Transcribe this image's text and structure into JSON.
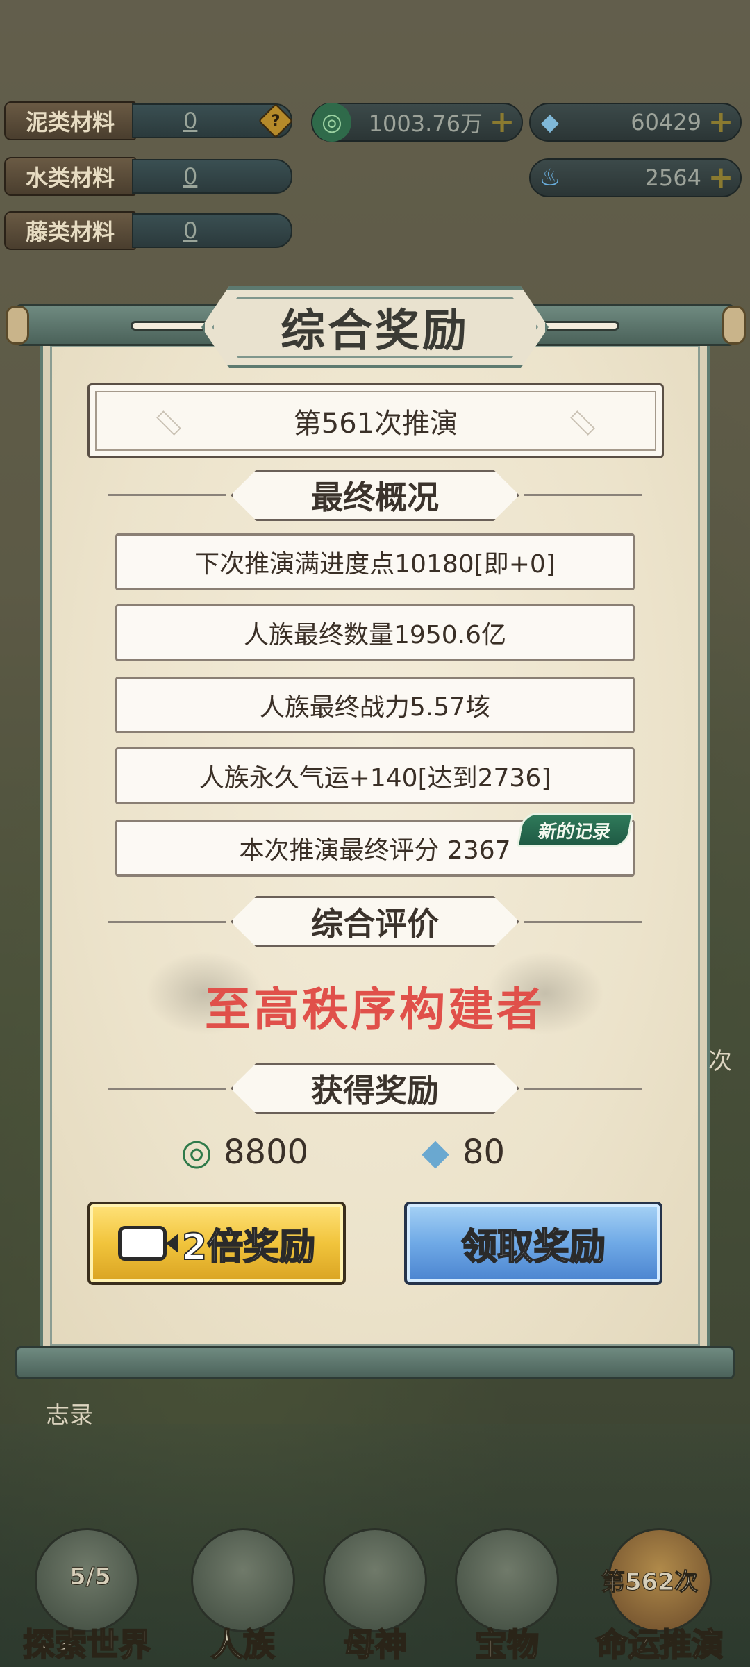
{
  "materials": [
    {
      "label": "泥类材料",
      "value": "0"
    },
    {
      "label": "水类材料",
      "value": "0"
    },
    {
      "label": "藤类材料",
      "value": "0"
    }
  ],
  "resources": {
    "coin": "1003.76万",
    "crystal": "60429",
    "flame": "2564"
  },
  "panel": {
    "title": "综合奖励",
    "round": "第561次推演",
    "summary_header": "最终概况",
    "stats": [
      "下次推演满进度点10180[即+0]",
      "人族最终数量1950.6亿",
      "人族最终战力5.57垓",
      "人族永久气运+140[达到2736]",
      "本次推演最终评分 2367"
    ],
    "new_record": "新的记录",
    "rating_header": "综合评价",
    "rating": "至高秩序构建者",
    "reward_header": "获得奖励",
    "rewards": {
      "coin": "8800",
      "crystal": "80"
    },
    "double_button": "2倍奖励",
    "claim_button": "领取奖励"
  },
  "side": {
    "left_label": "志录",
    "right_label": "次"
  },
  "nav": [
    {
      "label": "探索世界",
      "sub": "5/5"
    },
    {
      "label": "人族",
      "sub": ""
    },
    {
      "label": "母神",
      "sub": ""
    },
    {
      "label": "宝物",
      "sub": ""
    },
    {
      "label": "命运推演",
      "sub": "第562次"
    }
  ],
  "colors": {
    "accent_red": "#e0504a",
    "scroll_green": "#5e7a70",
    "button_gold": "#f1c43c",
    "button_blue": "#6fa9e6"
  }
}
